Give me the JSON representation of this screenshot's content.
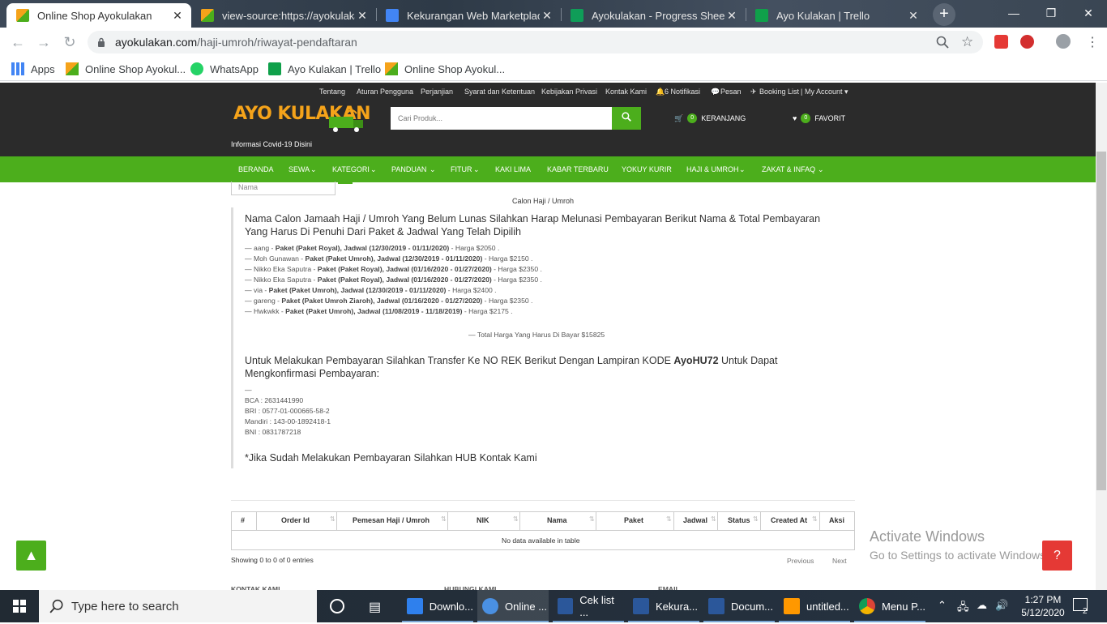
{
  "browser": {
    "tabs": [
      {
        "title": "Online Shop Ayokulakan",
        "active": true
      },
      {
        "title": "view-source:https://ayokulakan",
        "active": false
      },
      {
        "title": "Kekurangan Web Marketplace",
        "active": false
      },
      {
        "title": "Ayokulakan - Progress Sheet",
        "active": false
      },
      {
        "title": "Ayo Kulakan | Trello",
        "active": false
      }
    ],
    "url_host": "ayokulakan.com",
    "url_path": "/haji-umroh/riwayat-pendaftaran",
    "bookmarks": [
      "Apps",
      "Online Shop Ayokul...",
      "WhatsApp",
      "Ayo Kulakan | Trello",
      "Online Shop Ayokul..."
    ]
  },
  "site": {
    "top_links": [
      "Tentang",
      "Aturan Pengguna",
      "Perjanjian",
      "Syarat dan Ketentuan",
      "Kebijakan Privasi",
      "Kontak Kami",
      "6 Notifikasi",
      "Pesan",
      "Booking List",
      "My Account"
    ],
    "logo": "AYO KULAKAN",
    "covid": "Informasi Covid-19 Disini",
    "search_placeholder": "Cari Produk...",
    "cart_count": "0",
    "cart_label": "KERANJANG",
    "fav_count": "0",
    "fav_label": "FAVORIT",
    "nav": [
      "BERANDA",
      "SEWA",
      "KATEGORI",
      "PANDUAN",
      "FITUR",
      "KAKI LIMA",
      "KABAR TERBARU",
      "YOKUY KURIR",
      "HAJI & UMROH",
      "ZAKAT & INFAQ"
    ]
  },
  "content": {
    "nama_placeholder": "Nama",
    "breadcrumb": "Calon Haji / Umroh",
    "heading": "Nama Calon Jamaah Haji / Umroh Yang Belum Lunas Silahkan Harap Melunasi Pembayaran Berikut Nama & Total Pembayaran Yang Harus Di Penuhi Dari Paket & Jadwal Yang Telah Dipilih",
    "items": [
      {
        "name": "aang",
        "detail": "Paket (Paket Royal), Jadwal (12/30/2019 - 01/11/2020)",
        "price": "Harga $2050 ."
      },
      {
        "name": "Moh Gunawan",
        "detail": "Paket (Paket Umroh), Jadwal (12/30/2019 - 01/11/2020)",
        "price": "Harga $2150 ."
      },
      {
        "name": "Nikko Eka Saputra",
        "detail": "Paket (Paket Royal), Jadwal (01/16/2020 - 01/27/2020)",
        "price": "Harga $2350 ."
      },
      {
        "name": "Nikko Eka Saputra",
        "detail": "Paket (Paket Royal), Jadwal (01/16/2020 - 01/27/2020)",
        "price": "Harga $2350 ."
      },
      {
        "name": "via",
        "detail": "Paket (Paket Umroh), Jadwal (12/30/2019 - 01/11/2020)",
        "price": "Harga $2400 ."
      },
      {
        "name": "gareng",
        "detail": "Paket (Paket Umroh Ziaroh), Jadwal (01/16/2020 - 01/27/2020)",
        "price": "Harga $2350 ."
      },
      {
        "name": "Hwkwkk",
        "detail": "Paket (Paket Umroh), Jadwal (11/08/2019 - 11/18/2019)",
        "price": "Harga $2175 ."
      }
    ],
    "total": "— Total Harga Yang Harus Di Bayar $15825",
    "transfer_pre": "Untuk Melakukan Pembayaran Silahkan Transfer Ke NO REK Berikut Dengan Lampiran KODE ",
    "transfer_code": "AyoHU72",
    "transfer_post": " Untuk Dapat Mengkonfirmasi Pembayaran:",
    "dash": "—",
    "banks": [
      "BCA : 2631441990",
      "BRI : 0577-01-000665-58-2",
      "Mandiri : 143-00-1892418-1",
      "BNI : 0831787218"
    ],
    "hub": "*Jika Sudah Melakukan Pembayaran Silahkan HUB Kontak Kami"
  },
  "table": {
    "headers": [
      "#",
      "Order Id",
      "Pemesan Haji / Umroh",
      "NIK",
      "Nama",
      "Paket",
      "Jadwal",
      "Status",
      "Created At",
      "Aksi"
    ],
    "empty": "No data available in table",
    "showing": "Showing 0 to 0 of 0 entries",
    "prev": "Previous",
    "next": "Next"
  },
  "footer": [
    "KONTAK KAMI",
    "HUBUNGI KAMI",
    "EMAIL"
  ],
  "watermark": {
    "line1": "Activate Windows",
    "line2": "Go to Settings to activate Windows."
  },
  "taskbar": {
    "search": "Type here to search",
    "apps": [
      "Downlo...",
      "Online ...",
      "Cek list ...",
      "Kekura...",
      "Docum...",
      "untitled...",
      "Menu P..."
    ],
    "time": "1:27 PM",
    "date": "5/12/2020",
    "notif": "2"
  },
  "colors": {
    "brand_green": "#4cae1c",
    "header_dark": "#2b2b2b",
    "logo_orange": "#f5a31a",
    "help_red": "#e53935"
  }
}
